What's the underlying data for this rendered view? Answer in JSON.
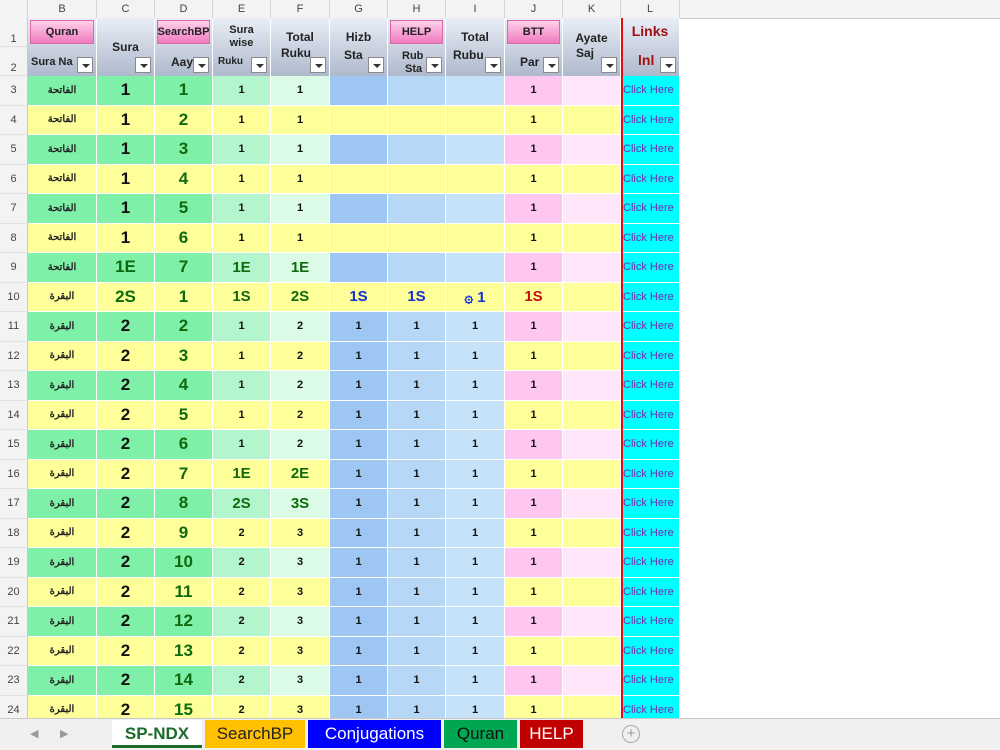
{
  "columns": [
    "B",
    "C",
    "D",
    "E",
    "F",
    "G",
    "H",
    "I",
    "J",
    "K",
    "L"
  ],
  "rownums": [
    "1",
    "2",
    "3",
    "4",
    "5",
    "6",
    "7",
    "8",
    "9",
    "10",
    "11",
    "12",
    "13",
    "14",
    "15",
    "16",
    "17",
    "18",
    "19",
    "20",
    "21",
    "22",
    "23",
    "24"
  ],
  "header": {
    "quran_btn": "Quran",
    "search_btn": "SearchBP",
    "help_btn": "HELP",
    "btt_btn": "BTT",
    "sura_name": "Sura Na",
    "sura": "Sura",
    "ayat": "Aay",
    "sura_wise_1": "Sura",
    "sura_wise_2": "wise",
    "sura_wise_3": "Ruku",
    "total_ruku_1": "Total",
    "total_ruku_2": "Ruku",
    "hizb_1": "Hizb",
    "hizb_2": "Sta",
    "rub_1": "Rub",
    "rub_2": "Sta",
    "total_rubu_1": "Total",
    "total_rubu_2": "Rubu",
    "para": "Par",
    "ayate_1": "Ayate",
    "ayate_2": "Saj",
    "links": "Links",
    "link2": "lnl"
  },
  "rows": [
    {
      "b": "الفاتحة",
      "c": "1",
      "d": "1",
      "e": "1",
      "f": "1",
      "g": "",
      "h": "",
      "i": "",
      "j": "1",
      "k": "",
      "l": "Click Here"
    },
    {
      "b": "الفاتحة",
      "c": "1",
      "d": "2",
      "e": "1",
      "f": "1",
      "g": "",
      "h": "",
      "i": "",
      "j": "1",
      "k": "",
      "l": "Click Here"
    },
    {
      "b": "الفاتحة",
      "c": "1",
      "d": "3",
      "e": "1",
      "f": "1",
      "g": "",
      "h": "",
      "i": "",
      "j": "1",
      "k": "",
      "l": "Click Here"
    },
    {
      "b": "الفاتحة",
      "c": "1",
      "d": "4",
      "e": "1",
      "f": "1",
      "g": "",
      "h": "",
      "i": "",
      "j": "1",
      "k": "",
      "l": "Click Here"
    },
    {
      "b": "الفاتحة",
      "c": "1",
      "d": "5",
      "e": "1",
      "f": "1",
      "g": "",
      "h": "",
      "i": "",
      "j": "1",
      "k": "",
      "l": "Click Here"
    },
    {
      "b": "الفاتحة",
      "c": "1",
      "d": "6",
      "e": "1",
      "f": "1",
      "g": "",
      "h": "",
      "i": "",
      "j": "1",
      "k": "",
      "l": "Click Here"
    },
    {
      "b": "الفاتحة",
      "c": "1E",
      "d": "7",
      "e": "1E",
      "f": "1E",
      "g": "",
      "h": "",
      "i": "",
      "j": "1",
      "k": "",
      "l": "Click Here"
    },
    {
      "b": "البقرة",
      "c": "2S",
      "d": "1",
      "e": "1S",
      "f": "2S",
      "g": "1S",
      "h": "1S",
      "i": "۞ 1",
      "j": "1S",
      "k": "",
      "l": "Click Here"
    },
    {
      "b": "البقرة",
      "c": "2",
      "d": "2",
      "e": "1",
      "f": "2",
      "g": "1",
      "h": "1",
      "i": "1",
      "j": "1",
      "k": "",
      "l": "Click Here"
    },
    {
      "b": "البقرة",
      "c": "2",
      "d": "3",
      "e": "1",
      "f": "2",
      "g": "1",
      "h": "1",
      "i": "1",
      "j": "1",
      "k": "",
      "l": "Click Here"
    },
    {
      "b": "البقرة",
      "c": "2",
      "d": "4",
      "e": "1",
      "f": "2",
      "g": "1",
      "h": "1",
      "i": "1",
      "j": "1",
      "k": "",
      "l": "Click Here"
    },
    {
      "b": "البقرة",
      "c": "2",
      "d": "5",
      "e": "1",
      "f": "2",
      "g": "1",
      "h": "1",
      "i": "1",
      "j": "1",
      "k": "",
      "l": "Click Here"
    },
    {
      "b": "البقرة",
      "c": "2",
      "d": "6",
      "e": "1",
      "f": "2",
      "g": "1",
      "h": "1",
      "i": "1",
      "j": "1",
      "k": "",
      "l": "Click Here"
    },
    {
      "b": "البقرة",
      "c": "2",
      "d": "7",
      "e": "1E",
      "f": "2E",
      "g": "1",
      "h": "1",
      "i": "1",
      "j": "1",
      "k": "",
      "l": "Click Here"
    },
    {
      "b": "البقرة",
      "c": "2",
      "d": "8",
      "e": "2S",
      "f": "3S",
      "g": "1",
      "h": "1",
      "i": "1",
      "j": "1",
      "k": "",
      "l": "Click Here"
    },
    {
      "b": "البقرة",
      "c": "2",
      "d": "9",
      "e": "2",
      "f": "3",
      "g": "1",
      "h": "1",
      "i": "1",
      "j": "1",
      "k": "",
      "l": "Click Here"
    },
    {
      "b": "البقرة",
      "c": "2",
      "d": "10",
      "e": "2",
      "f": "3",
      "g": "1",
      "h": "1",
      "i": "1",
      "j": "1",
      "k": "",
      "l": "Click Here"
    },
    {
      "b": "البقرة",
      "c": "2",
      "d": "11",
      "e": "2",
      "f": "3",
      "g": "1",
      "h": "1",
      "i": "1",
      "j": "1",
      "k": "",
      "l": "Click Here"
    },
    {
      "b": "البقرة",
      "c": "2",
      "d": "12",
      "e": "2",
      "f": "3",
      "g": "1",
      "h": "1",
      "i": "1",
      "j": "1",
      "k": "",
      "l": "Click Here"
    },
    {
      "b": "البقرة",
      "c": "2",
      "d": "13",
      "e": "2",
      "f": "3",
      "g": "1",
      "h": "1",
      "i": "1",
      "j": "1",
      "k": "",
      "l": "Click Here"
    },
    {
      "b": "البقرة",
      "c": "2",
      "d": "14",
      "e": "2",
      "f": "3",
      "g": "1",
      "h": "1",
      "i": "1",
      "j": "1",
      "k": "",
      "l": "Click Here"
    },
    {
      "b": "البقرة",
      "c": "2",
      "d": "15",
      "e": "2",
      "f": "3",
      "g": "1",
      "h": "1",
      "i": "1",
      "j": "1",
      "k": "",
      "l": "Click Here"
    }
  ],
  "tabs": [
    {
      "label": "SP-NDX",
      "active": true,
      "bg": "#ffffff",
      "fg": "#1d6b2a"
    },
    {
      "label": "SearchBP",
      "active": false,
      "bg": "#ffc000",
      "fg": "#222222"
    },
    {
      "label": "Conjugations",
      "active": false,
      "bg": "#0000ff",
      "fg": "#ffffff"
    },
    {
      "label": "Quran",
      "active": false,
      "bg": "#00a651",
      "fg": "#111111"
    },
    {
      "label": "HELP",
      "active": false,
      "bg": "#c00000",
      "fg": "#ffffff"
    }
  ],
  "colors": {
    "green_row": "#7ff0a8",
    "yellow_row": "#ffff99",
    "hizb_blue": "#9ec6f2",
    "rubu_light": "#c6e2f8",
    "para_pink": "#ffc6f0",
    "ayate_pink": "#ffe6fa",
    "link_cyan": "#00ffff"
  }
}
